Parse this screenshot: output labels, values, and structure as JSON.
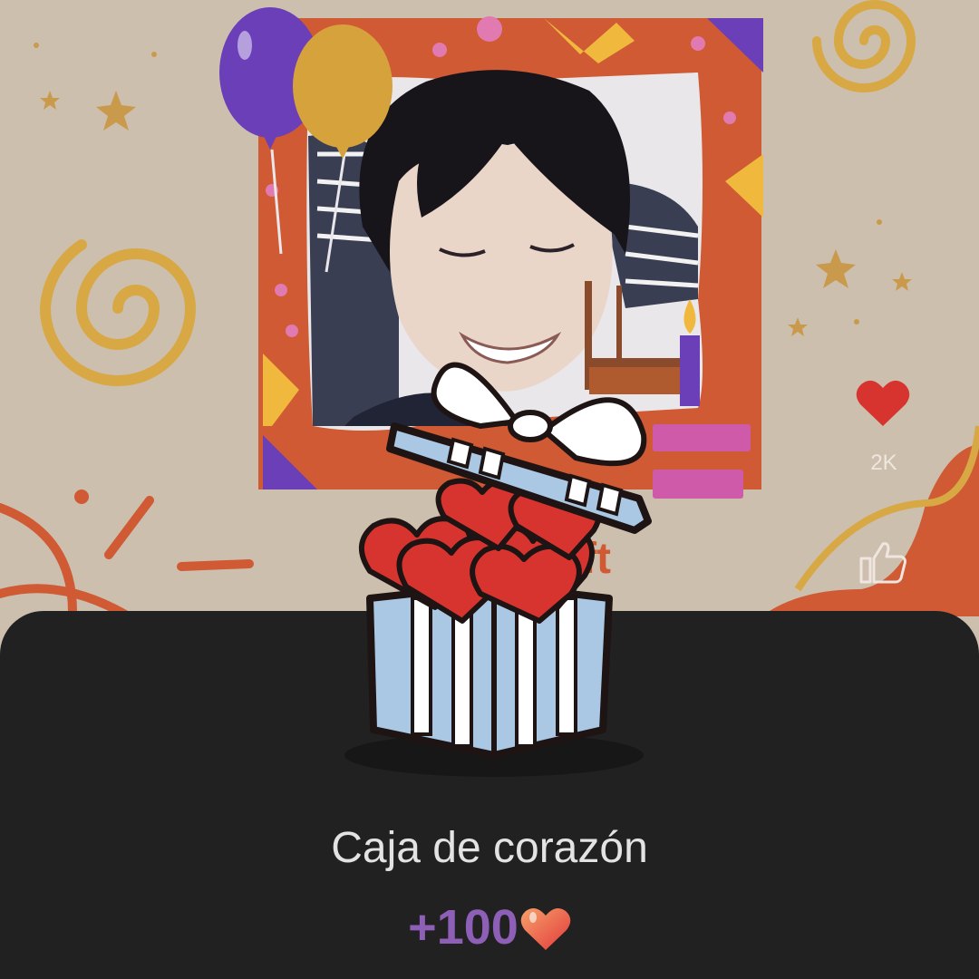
{
  "background": {
    "poster_partial_text": "ft",
    "photo_alt": "smiling person with eyes closed in a party frame"
  },
  "side_actions": {
    "like_count": "2K",
    "like_icon": "heart-icon",
    "thumb_icon": "thumbs-up-icon"
  },
  "gift_sheet": {
    "gift_name": "Caja de corazón",
    "reward_value": "+100",
    "reward_icon": "heart-icon",
    "gift_icon": "heart-gift-box-icon"
  },
  "colors": {
    "sheet_bg": "#212121",
    "reward_text": "#8e5fb6",
    "heart_red": "#d8342f",
    "poster_orange": "#cf5a33"
  }
}
